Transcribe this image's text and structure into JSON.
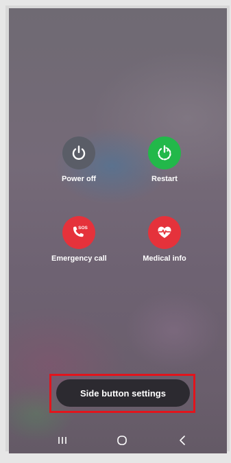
{
  "power_menu": {
    "power_off_label": "Power off",
    "restart_label": "Restart",
    "emergency_call_label": "Emergency call",
    "medical_info_label": "Medical info",
    "sos_badge": "SOS"
  },
  "side_button_settings_label": "Side button settings",
  "colors": {
    "power_off": "#5a5d67",
    "restart": "#22b84a",
    "emergency": "#e5323b",
    "medical": "#e5323b",
    "highlight": "#e2141c"
  },
  "navbar": {
    "recents_icon": "recents-icon",
    "home_icon": "home-icon",
    "back_icon": "back-icon"
  }
}
